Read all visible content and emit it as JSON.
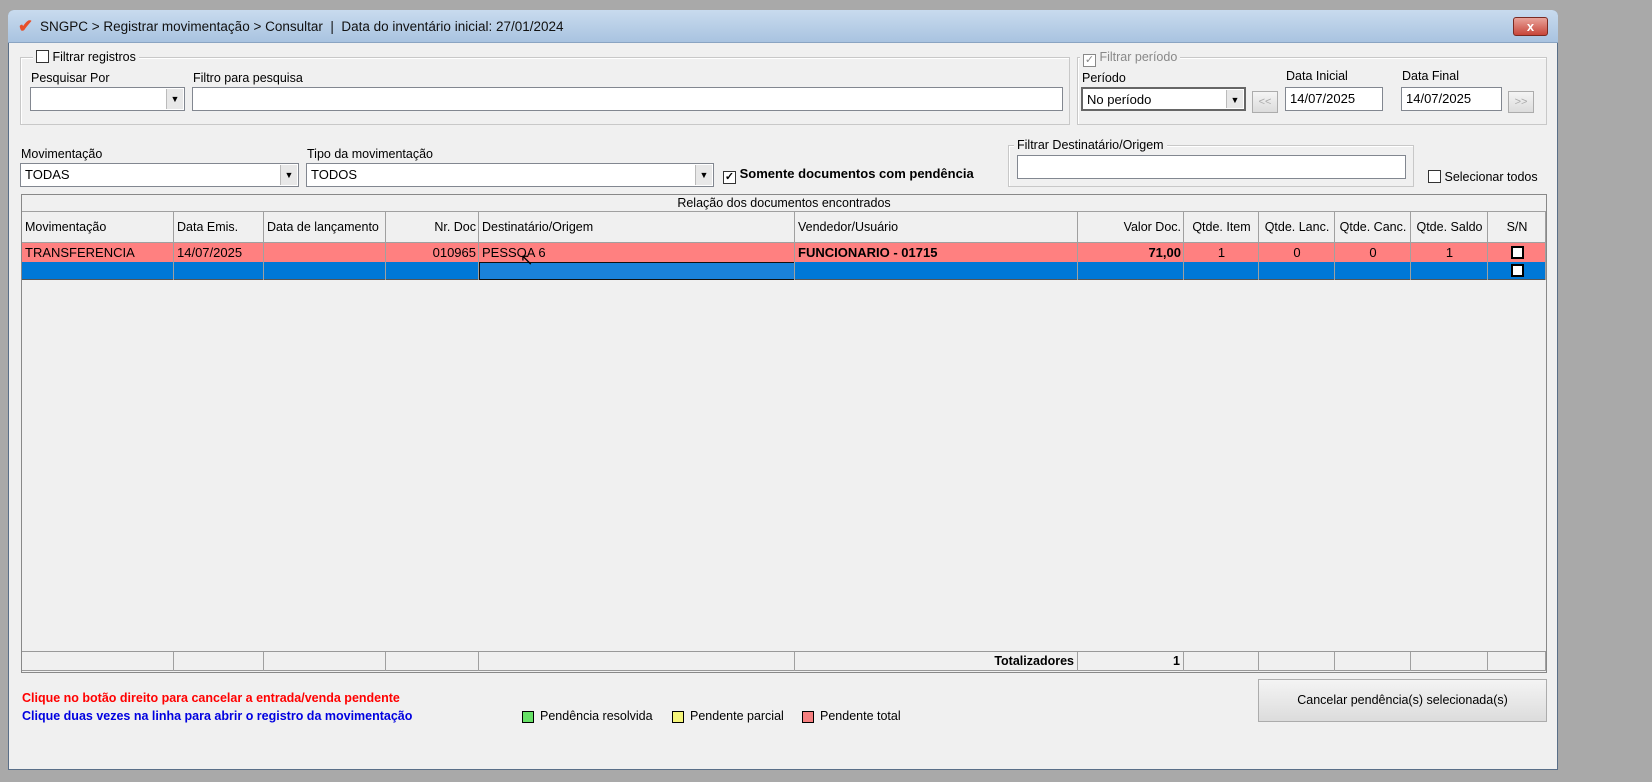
{
  "window": {
    "title": "SNGPC > Registrar movimentação > Consultar  |  Data do inventário inicial: 27/01/2024",
    "close_label": "x"
  },
  "filter_records": {
    "label": "Filtrar registros",
    "checked": false,
    "search_by_label": "Pesquisar Por",
    "search_by_value": "",
    "filter_label": "Filtro para pesquisa",
    "filter_value": ""
  },
  "filter_period": {
    "label": "Filtrar período",
    "checked": true,
    "period_label": "Período",
    "period_value": "No período",
    "start_label": "Data Inicial",
    "start_value": "14/07/2025",
    "end_label": "Data Final",
    "end_value": "14/07/2025",
    "prev_label": "<<",
    "next_label": ">>"
  },
  "movement": {
    "label": "Movimentação",
    "value": "TODAS"
  },
  "movement_type": {
    "label": "Tipo da movimentação",
    "value": "TODOS"
  },
  "pending_only": {
    "label": "Somente documentos com pendência",
    "checked": true
  },
  "recipient_filter": {
    "label": "Filtrar Destinatário/Origem",
    "value": ""
  },
  "select_all": {
    "label": "Selecionar todos",
    "checked": false
  },
  "table": {
    "caption": "Relação dos documentos encontrados",
    "columns": [
      "Movimentação",
      "Data Emis.",
      "Data de lançamento",
      "Nr. Doc",
      "Destinatário/Origem",
      "Vendedor/Usuário",
      "Valor Doc.",
      "Qtde. Item",
      "Qtde. Lanc.",
      "Qtde. Canc.",
      "Qtde. Saldo",
      "S/N"
    ],
    "rows": [
      [
        "TRANSFERENCIA",
        "14/07/2025",
        "",
        "010965",
        "PESSOA 6",
        "FUNCIONARIO - 01715",
        "71,00",
        "1",
        "0",
        "0",
        "1",
        ""
      ]
    ],
    "totals_label": "Totalizadores",
    "totals_value": "1"
  },
  "hints": {
    "right_click": "Clique no botão direito para cancelar a entrada/venda pendente",
    "double_click": "Clique duas vezes na linha para abrir o registro da movimentação"
  },
  "legend": [
    {
      "label": "Pendência resolvida",
      "color": "#66e066"
    },
    {
      "label": "Pendente parcial",
      "color": "#f5f57a"
    },
    {
      "label": "Pendente total",
      "color": "#f57f7f"
    }
  ],
  "cancel_button": "Cancelar pendência(s) selecionada(s)",
  "colors": {
    "row_pending": "#ff8080",
    "row_selected": "#0078d7"
  }
}
